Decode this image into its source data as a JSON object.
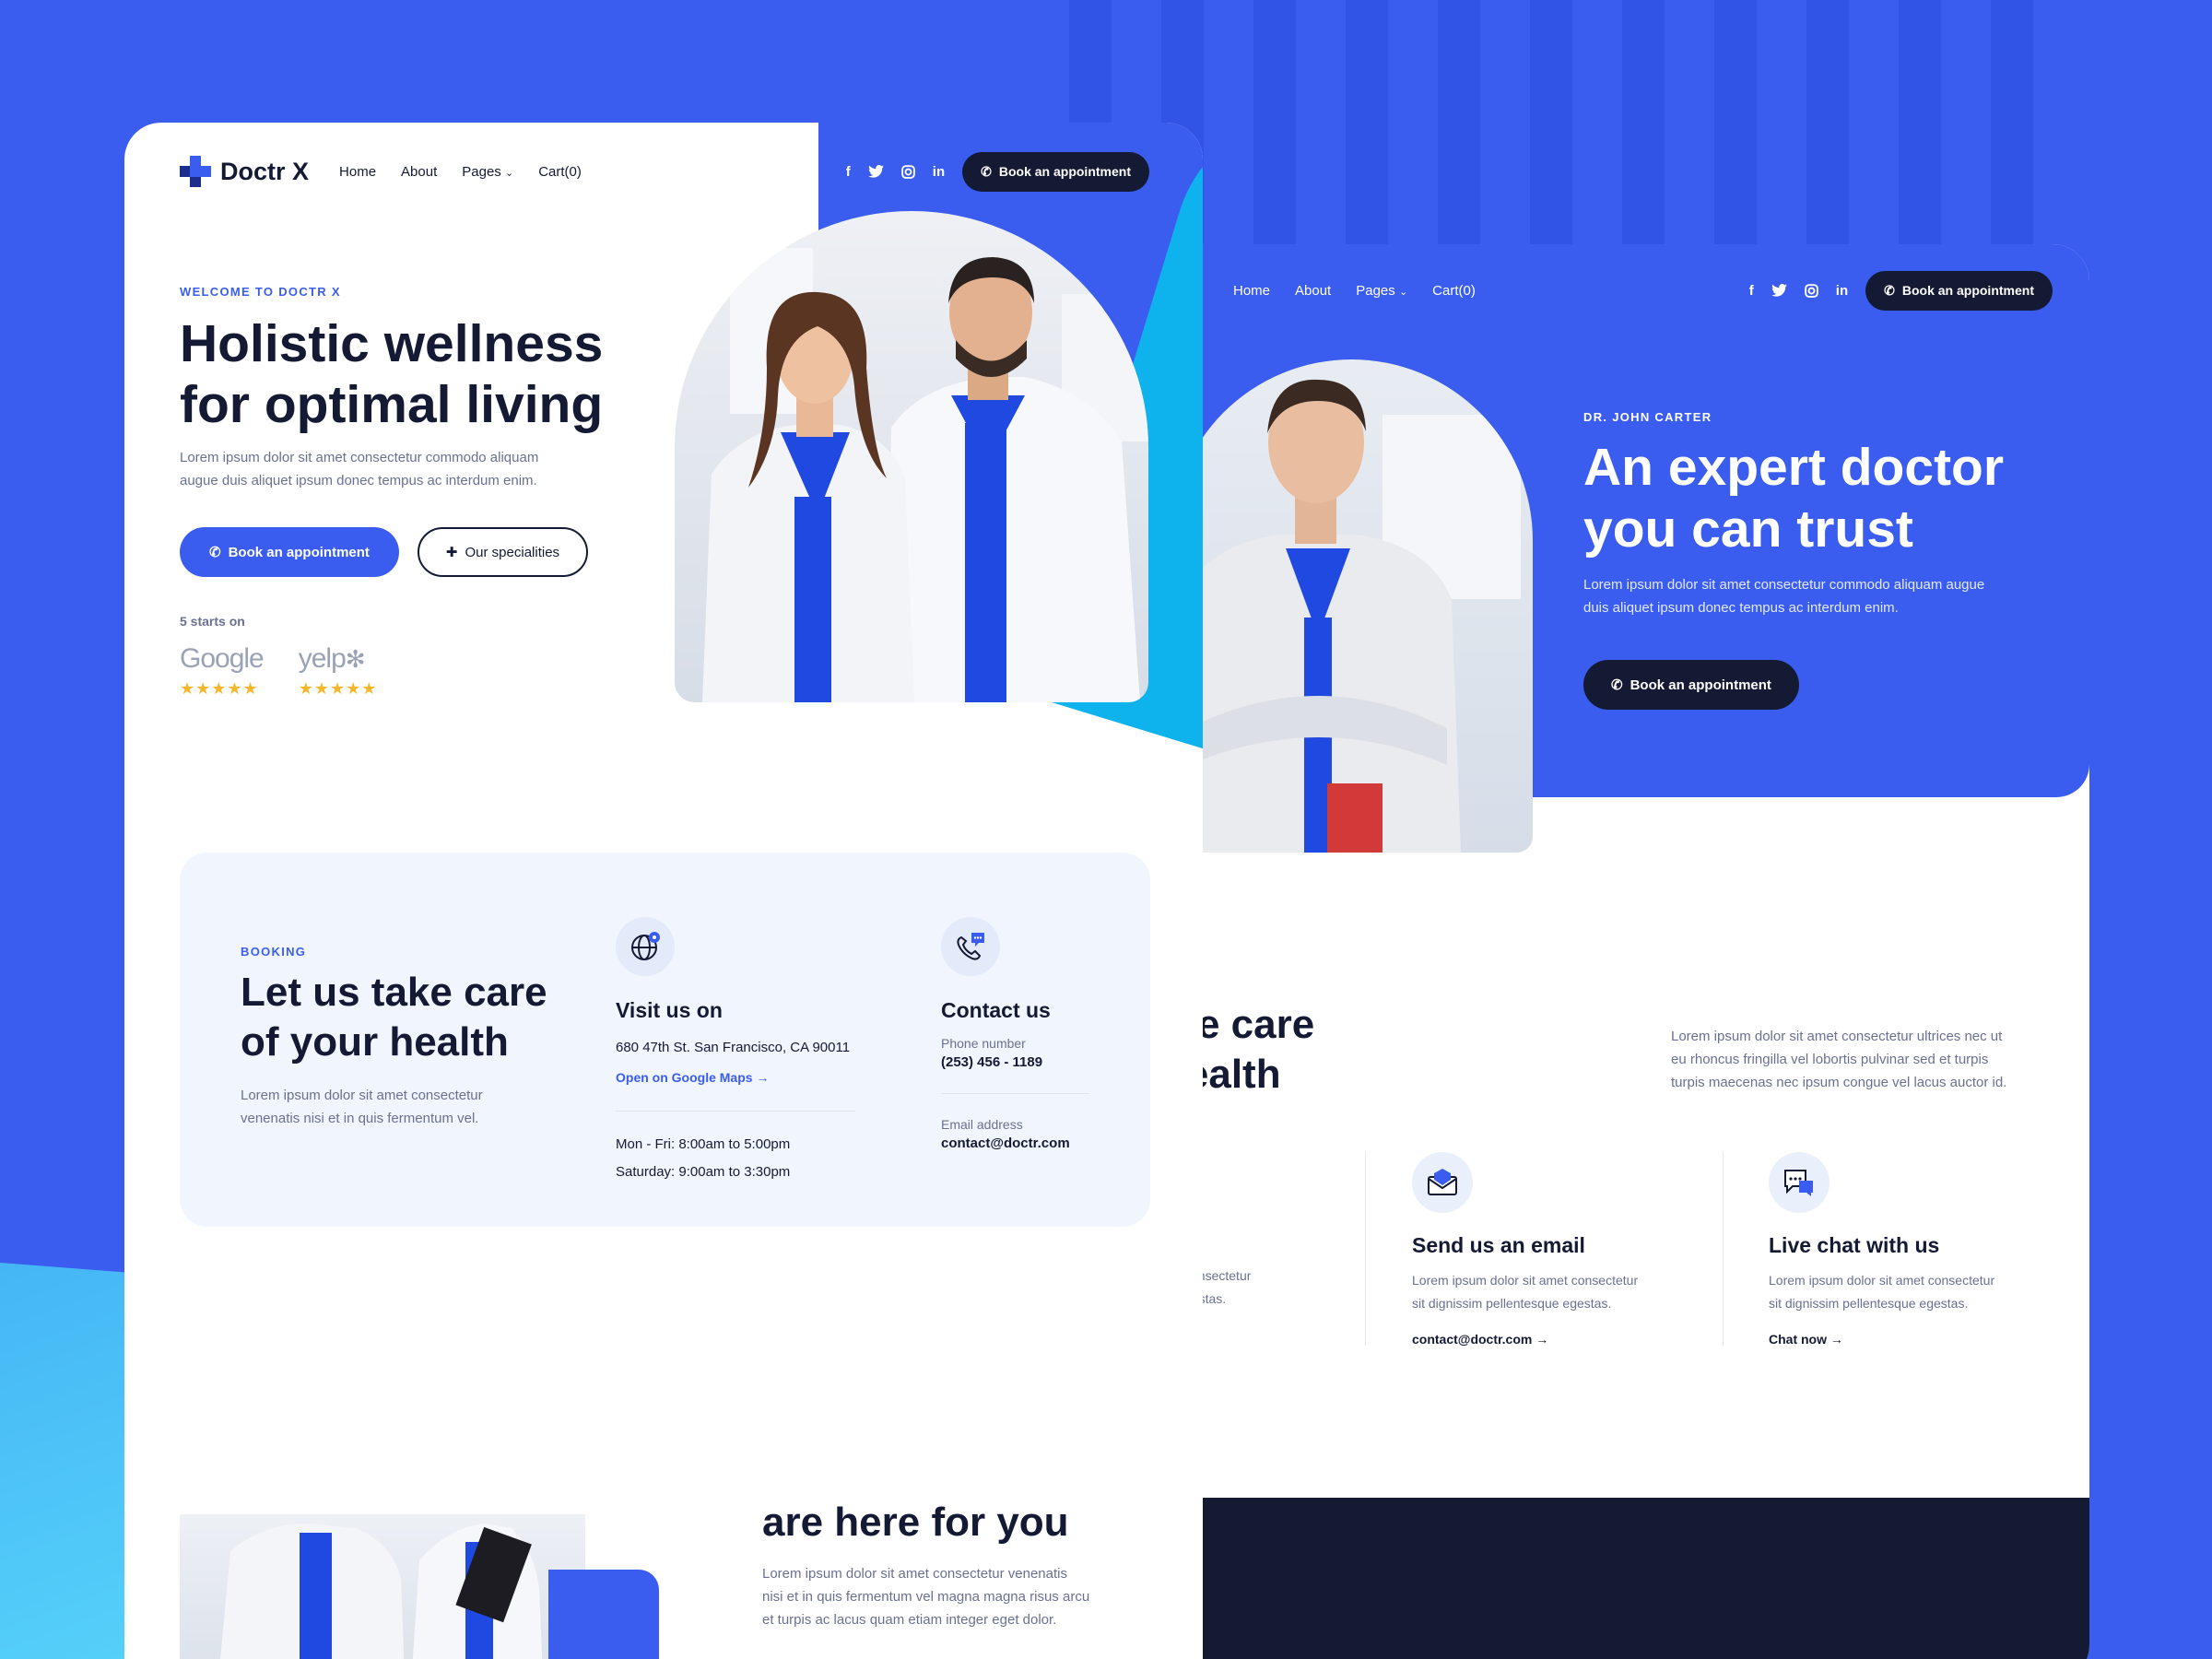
{
  "front": {
    "logo": "Doctr X",
    "nav": {
      "home": "Home",
      "about": "About",
      "pages": "Pages",
      "cart": "Cart(0)"
    },
    "social": {
      "facebook": "f",
      "twitter": "twitter",
      "instagram": "instagram",
      "linkedin": "in"
    },
    "book_button": "Book an appointment",
    "hero": {
      "eyebrow": "WELCOME TO DOCTR X",
      "title_line1": "Holistic wellness",
      "title_line2": "for optimal living",
      "desc_line1": "Lorem ipsum dolor sit amet consectetur commodo aliquam",
      "desc_line2": "augue duis aliquet ipsum donec tempus ac interdum enim.",
      "primary_button": "Book an appointment",
      "secondary_button": "Our specialities",
      "rating_label": "5 starts on",
      "ratings": [
        {
          "brand": "Google",
          "stars": "★★★★★"
        },
        {
          "brand": "yelp",
          "stars": "★★★★★"
        }
      ]
    },
    "booking": {
      "eyebrow": "BOOKING",
      "title_line1": "Let us take care",
      "title_line2": "of your health",
      "desc_line1": "Lorem ipsum dolor sit amet consectetur",
      "desc_line2": "venenatis nisi et in quis fermentum vel.",
      "visit": {
        "title": "Visit us on",
        "address": "680 47th St. San Francisco, CA 90011",
        "maps_link": "Open on Google Maps",
        "hours1": "Mon - Fri: 8:00am to 5:00pm",
        "hours2": "Saturday: 9:00am to 3:30pm"
      },
      "contact": {
        "title": "Contact us",
        "phone_label": "Phone number",
        "phone": "(253) 456 - 1189",
        "email_label": "Email address",
        "email": "contact@doctr.com"
      }
    },
    "bottom": {
      "title": "are here for you",
      "desc_line1": "Lorem ipsum dolor sit amet consectetur venenatis",
      "desc_line2": "nisi et in quis fermentum vel magna magna risus arcu",
      "desc_line3": "et turpis ac lacus quam etiam integer eget dolor."
    }
  },
  "back": {
    "nav": {
      "home": "Home",
      "about": "About",
      "pages": "Pages",
      "cart": "Cart(0)"
    },
    "book_button": "Book an appointment",
    "hero": {
      "eyebrow": "DR. JOHN CARTER",
      "title_line1": "An expert doctor",
      "title_line2": "you can trust",
      "desc_line1": "Lorem ipsum dolor sit amet consectetur commodo aliquam augue",
      "desc_line2": "duis aliquet ipsum donec tempus ac interdum enim.",
      "button": "Book an appointment"
    },
    "section": {
      "title_line1": "ake care",
      "title_line2": "health",
      "para_line1": "Lorem ipsum dolor sit amet consectetur ultrices nec ut",
      "para_line2": "eu rhoncus fringilla vel lobortis pulvinar sed et turpis",
      "para_line3": "turpis maecenas nec ipsum congue vel lacus auctor id."
    },
    "features": {
      "partial_line1": "amet consectetur",
      "partial_line2": "que egestas.",
      "email": {
        "title": "Send us an email",
        "line1": "Lorem ipsum dolor sit amet consectetur",
        "line2": "sit dignissim pellentesque egestas.",
        "link": "contact@doctr.com"
      },
      "chat": {
        "title": "Live chat with us",
        "line1": "Lorem ipsum dolor sit amet consectetur",
        "line2": "sit dignissim pellentesque egestas.",
        "link": "Chat now"
      }
    }
  },
  "colors": {
    "primary": "#3a5df0",
    "dark": "#141a33",
    "cyan": "#0eb2ec",
    "light_bg": "#f1f5fd",
    "star": "#f6b72c"
  },
  "icons": [
    "plus-logo-icon",
    "chevron-down-icon",
    "facebook-icon",
    "twitter-icon",
    "instagram-icon",
    "linkedin-icon",
    "phone-icon",
    "plus-outline-icon",
    "globe-pin-icon",
    "phone-chat-icon",
    "arrow-right-icon",
    "envelope-icon",
    "chat-bubble-icon"
  ]
}
